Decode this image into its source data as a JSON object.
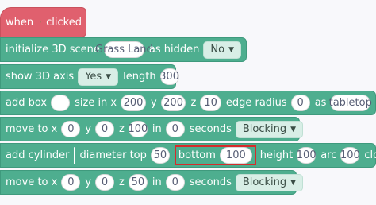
{
  "hat": {
    "prefix": "when",
    "suffix": "clicked",
    "icon": "green-flag-icon"
  },
  "blocks": [
    {
      "label": "initialize 3D scene",
      "scene": "Grass Land",
      "hidden_label": "as hidden",
      "hidden_value": "No"
    },
    {
      "label": "show 3D axis",
      "axis_value": "Yes",
      "length_label": "length",
      "length_value": "300"
    },
    {
      "label": "add box",
      "color": "#ffffff",
      "size_label": "size in x",
      "x": "200",
      "y_label": "y",
      "y": "200",
      "z_label": "z",
      "z": "10",
      "edge_label": "edge radius",
      "edge": "0",
      "as_label": "as",
      "name": "tabletop"
    },
    {
      "label": "move to x",
      "x": "0",
      "y_label": "y",
      "y": "0",
      "z_label": "z",
      "z": "100",
      "in_label": "in",
      "secs": "0",
      "secs_label": "seconds",
      "mode": "Blocking"
    },
    {
      "label": "add cylinder",
      "color": "#b85e0b",
      "dtop_label": "diameter top",
      "dtop": "50",
      "bottom_label": "bottom",
      "bottom": "100",
      "height_label": "height",
      "height": "100",
      "arc_label": "arc",
      "arc": "100",
      "clos_label": "clos"
    },
    {
      "label": "move to x",
      "x": "0",
      "y_label": "y",
      "y": "0",
      "z_label": "z",
      "z": "50",
      "in_label": "in",
      "secs": "0",
      "secs_label": "seconds",
      "mode": "Blocking"
    }
  ]
}
